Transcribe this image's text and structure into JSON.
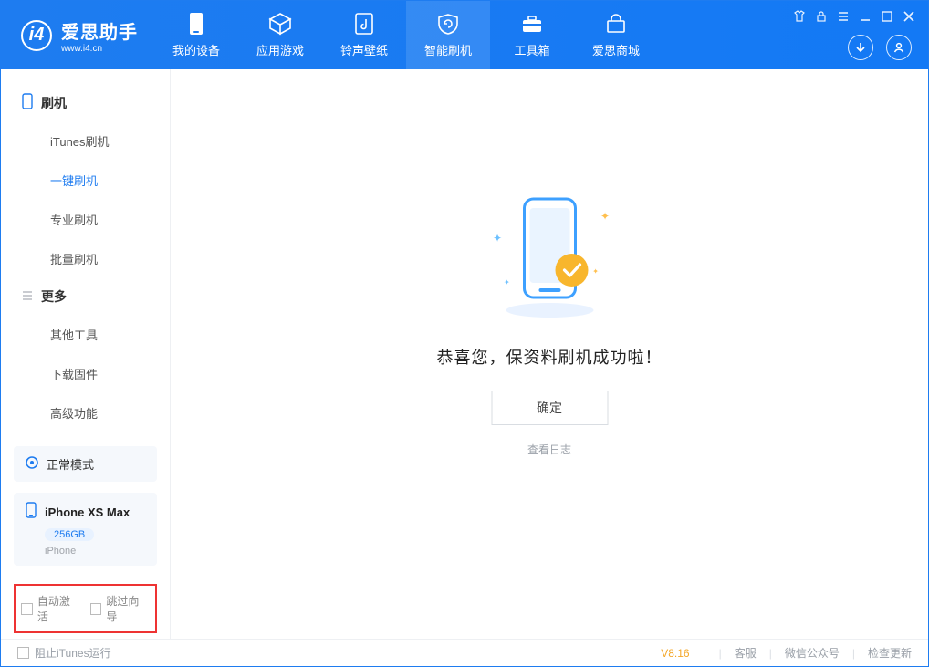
{
  "app": {
    "name_cn": "爱思助手",
    "name_en": "www.i4.cn"
  },
  "nav": [
    {
      "label": "我的设备"
    },
    {
      "label": "应用游戏"
    },
    {
      "label": "铃声壁纸"
    },
    {
      "label": "智能刷机"
    },
    {
      "label": "工具箱"
    },
    {
      "label": "爱思商城"
    }
  ],
  "sidebar": {
    "group1_title": "刷机",
    "group1": [
      {
        "label": "iTunes刷机"
      },
      {
        "label": "一键刷机"
      },
      {
        "label": "专业刷机"
      },
      {
        "label": "批量刷机"
      }
    ],
    "group2_title": "更多",
    "group2": [
      {
        "label": "其他工具"
      },
      {
        "label": "下载固件"
      },
      {
        "label": "高级功能"
      }
    ],
    "mode": "正常模式",
    "device": {
      "name": "iPhone XS Max",
      "capacity": "256GB",
      "type": "iPhone"
    },
    "check1": "自动激活",
    "check2": "跳过向导"
  },
  "main": {
    "success_text": "恭喜您，保资料刷机成功啦！",
    "ok_btn": "确定",
    "view_log": "查看日志"
  },
  "footer": {
    "block_itunes": "阻止iTunes运行",
    "version": "V8.16",
    "links": [
      "客服",
      "微信公众号",
      "检查更新"
    ]
  }
}
